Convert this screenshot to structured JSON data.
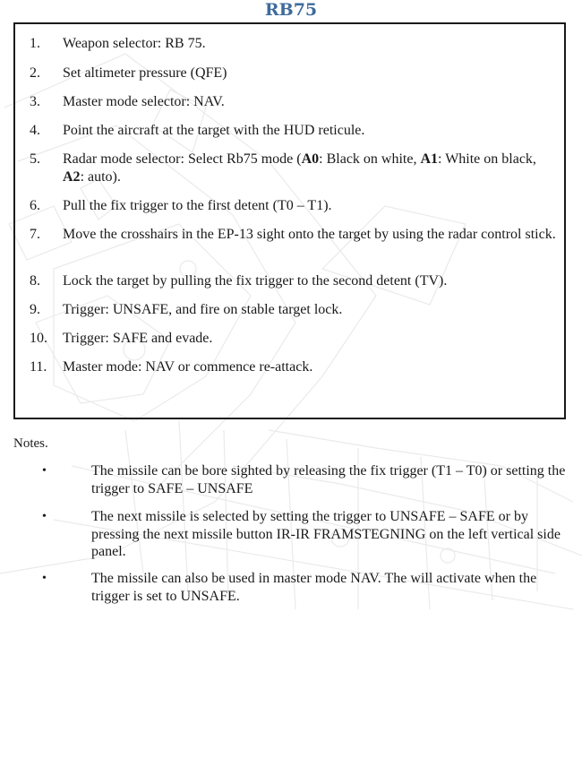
{
  "title": "RB75",
  "steps": [
    {
      "num": "1.",
      "text": "Weapon selector: RB 75."
    },
    {
      "num": "2.",
      "text": "Set altimeter pressure (QFE)"
    },
    {
      "num": "3.",
      "text": "Master mode selector: NAV."
    },
    {
      "num": "4.",
      "text": "Point the aircraft at the target with the HUD reticule."
    },
    {
      "num": "5.",
      "text_a": "Radar mode selector: Select Rb75 mode (",
      "a0": "A0",
      "text_b": ": Black on white, ",
      "a1": "A1",
      "text_c": ": White on black, ",
      "a2": "A2",
      "text_d": ": auto)."
    },
    {
      "num": "6.",
      "text": "Pull the fix trigger to the first detent (T0 – T1)."
    },
    {
      "num": "7.",
      "text": "Move the crosshairs in the EP-13 sight onto the target by using the radar control stick."
    },
    {
      "num": "8.",
      "text": "Lock the target by pulling the fix trigger to the second detent (TV)."
    },
    {
      "num": "9.",
      "text": "Trigger: UNSAFE, and fire on stable target lock."
    },
    {
      "num": "10.",
      "text": "Trigger: SAFE and evade."
    },
    {
      "num": "11.",
      "text": "Master mode: NAV or commence re-attack."
    }
  ],
  "notes_label": "Notes.",
  "bullet": "•",
  "notes": [
    "The missile can be bore sighted by releasing the fix trigger (T1 – T0) or setting the trigger to SAFE – UNSAFE",
    "The next missile is selected by setting the trigger to UNSAFE – SAFE or by pressing the next missile button IR-IR FRAMSTEGNING on the left vertical side panel.",
    "The missile can also be used in master mode NAV. The will activate when the trigger is set to UNSAFE."
  ]
}
